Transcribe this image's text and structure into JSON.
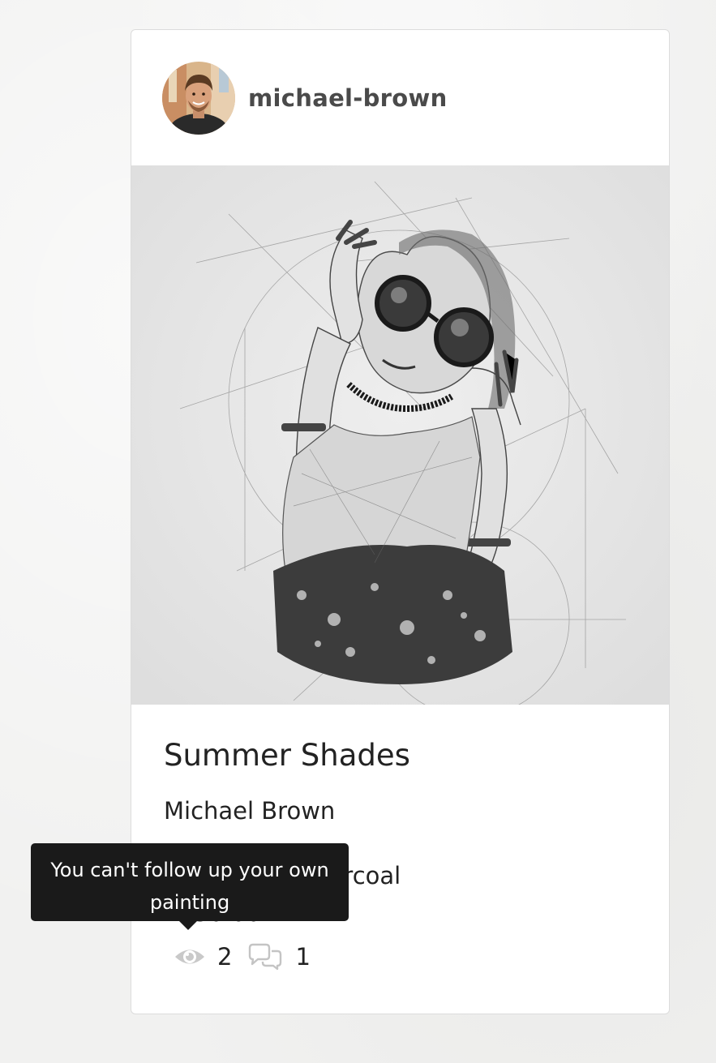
{
  "header": {
    "username": "michael-brown"
  },
  "artwork": {
    "title": "Summer Shades",
    "artist": "Michael Brown",
    "technique": "Technique: Charcoal",
    "price": "£550.00"
  },
  "stats": {
    "views": "2",
    "comments": "1"
  },
  "tooltip": {
    "text": "You can't follow up your own painting"
  },
  "icons": {
    "views": "eye-icon",
    "comments": "comments-icon"
  },
  "colors": {
    "background": "#f1f1f0",
    "card": "#ffffff",
    "tooltip_bg": "#1a1a1a",
    "icon_gray": "#c8c8c8",
    "username": "#4a4a4a"
  }
}
